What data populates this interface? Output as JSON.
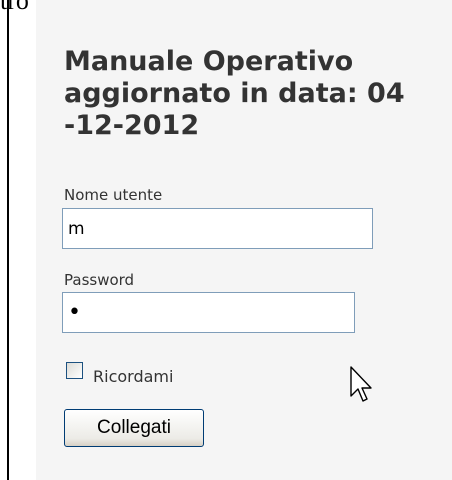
{
  "background_text": "tro Pagine.",
  "login": {
    "heading_lines": [
      "Manuale Operativo",
      "aggiornato in data: 04",
      "-12-2012"
    ],
    "username_label": "Nome utente",
    "username_value": "m",
    "password_label": "Password",
    "password_display": "•",
    "remember_label": "Ricordami",
    "remember_checked": false,
    "submit_label": "Collegati"
  },
  "icons": {
    "cursor": "mouse-pointer-icon"
  },
  "colors": {
    "panel_bg": "#f5f5f5",
    "input_border": "#7f9db9",
    "button_border": "#003c74",
    "heading_text": "#333333"
  }
}
